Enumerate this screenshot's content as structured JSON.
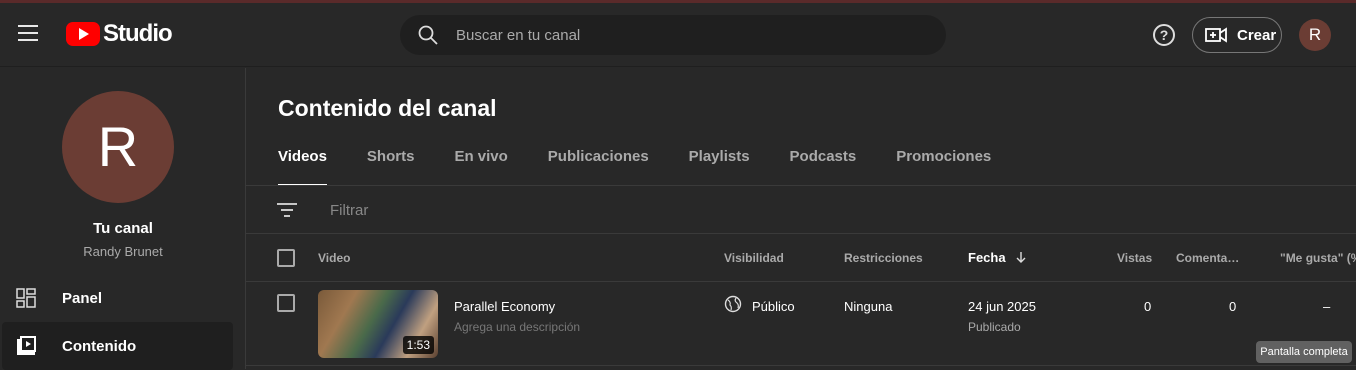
{
  "header": {
    "logo_text": "Studio",
    "search_placeholder": "Buscar en tu canal",
    "create_label": "Crear",
    "avatar_letter": "R"
  },
  "sidebar": {
    "avatar_letter": "R",
    "channel_title": "Tu canal",
    "channel_user": "Randy Brunet",
    "items": [
      {
        "label": "Panel",
        "icon": "dashboard-icon",
        "active": false
      },
      {
        "label": "Contenido",
        "icon": "content-icon",
        "active": true
      }
    ]
  },
  "main": {
    "title": "Contenido del canal",
    "tabs": [
      {
        "label": "Videos",
        "active": true
      },
      {
        "label": "Shorts",
        "active": false
      },
      {
        "label": "En vivo",
        "active": false
      },
      {
        "label": "Publicaciones",
        "active": false
      },
      {
        "label": "Playlists",
        "active": false
      },
      {
        "label": "Podcasts",
        "active": false
      },
      {
        "label": "Promociones",
        "active": false
      }
    ],
    "filter_placeholder": "Filtrar",
    "columns": {
      "video": "Video",
      "visibility": "Visibilidad",
      "restrictions": "Restricciones",
      "date": "Fecha",
      "views": "Vistas",
      "comments": "Comenta…",
      "likes": "\"Me gusta\" (%"
    },
    "rows": [
      {
        "title": "Parallel Economy",
        "description": "Agrega una descripción",
        "duration": "1:53",
        "visibility": "Público",
        "restrictions": "Ninguna",
        "date": "24 jun 2025",
        "date_status": "Publicado",
        "views": "0",
        "comments": "0",
        "likes": "–"
      }
    ]
  },
  "tooltip": "Pantalla completa",
  "colors": {
    "background": "#282828",
    "brand_red": "#ff0000",
    "avatar": "#6b3d34"
  }
}
